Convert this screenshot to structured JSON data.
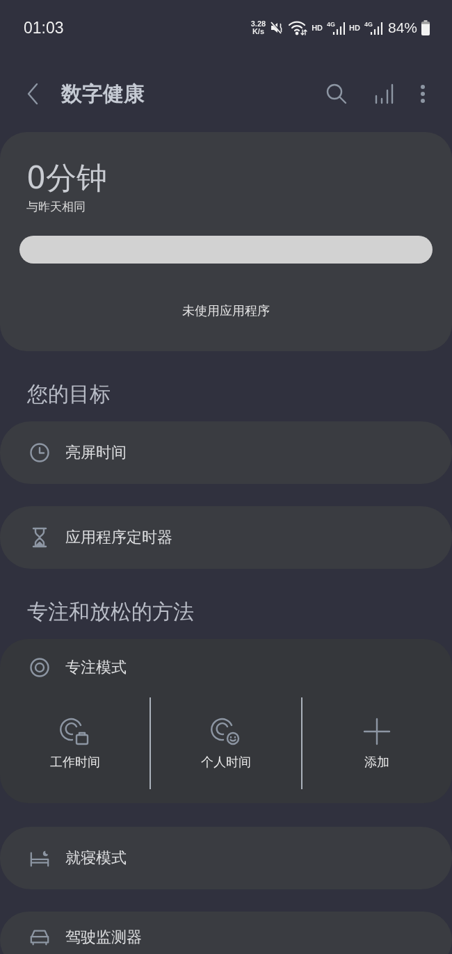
{
  "status_bar": {
    "time": "01:03",
    "net_speed": "3.28",
    "net_speed_unit": "K/s",
    "sim_1": "HD",
    "sim_1_network": "4G",
    "sim_2": "HD",
    "sim_2_network": "4G",
    "battery": "84%"
  },
  "app_bar": {
    "title": "数字健康"
  },
  "summary": {
    "total": "0分钟",
    "comparison": "与昨天相同",
    "empty_message": "未使用应用程序"
  },
  "goals": {
    "heading": "您的目标",
    "items": [
      {
        "kind": "screen-time",
        "label": "亮屏时间"
      },
      {
        "kind": "app-timer",
        "label": "应用程序定时器"
      }
    ]
  },
  "focus_relax": {
    "heading": "专注和放松的方法",
    "focus_mode": {
      "label": "专注模式",
      "modes": [
        {
          "kind": "work",
          "label": "工作时间"
        },
        {
          "kind": "personal",
          "label": "个人时间"
        },
        {
          "kind": "add",
          "label": "添加"
        }
      ]
    },
    "items": [
      {
        "kind": "bedtime",
        "label": "就寝模式"
      },
      {
        "kind": "driving",
        "label": "驾驶监测器"
      }
    ]
  }
}
